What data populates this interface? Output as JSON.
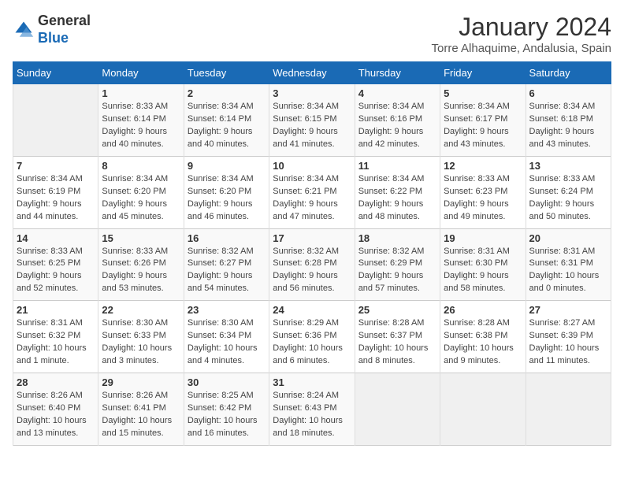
{
  "logo": {
    "line1": "General",
    "line2": "Blue"
  },
  "title": "January 2024",
  "subtitle": "Torre Alhaquime, Andalusia, Spain",
  "columns": [
    "Sunday",
    "Monday",
    "Tuesday",
    "Wednesday",
    "Thursday",
    "Friday",
    "Saturday"
  ],
  "rows": [
    [
      {
        "num": "",
        "info": ""
      },
      {
        "num": "1",
        "info": "Sunrise: 8:33 AM\nSunset: 6:14 PM\nDaylight: 9 hours\nand 40 minutes."
      },
      {
        "num": "2",
        "info": "Sunrise: 8:34 AM\nSunset: 6:14 PM\nDaylight: 9 hours\nand 40 minutes."
      },
      {
        "num": "3",
        "info": "Sunrise: 8:34 AM\nSunset: 6:15 PM\nDaylight: 9 hours\nand 41 minutes."
      },
      {
        "num": "4",
        "info": "Sunrise: 8:34 AM\nSunset: 6:16 PM\nDaylight: 9 hours\nand 42 minutes."
      },
      {
        "num": "5",
        "info": "Sunrise: 8:34 AM\nSunset: 6:17 PM\nDaylight: 9 hours\nand 43 minutes."
      },
      {
        "num": "6",
        "info": "Sunrise: 8:34 AM\nSunset: 6:18 PM\nDaylight: 9 hours\nand 43 minutes."
      }
    ],
    [
      {
        "num": "7",
        "info": "Sunrise: 8:34 AM\nSunset: 6:19 PM\nDaylight: 9 hours\nand 44 minutes."
      },
      {
        "num": "8",
        "info": "Sunrise: 8:34 AM\nSunset: 6:20 PM\nDaylight: 9 hours\nand 45 minutes."
      },
      {
        "num": "9",
        "info": "Sunrise: 8:34 AM\nSunset: 6:20 PM\nDaylight: 9 hours\nand 46 minutes."
      },
      {
        "num": "10",
        "info": "Sunrise: 8:34 AM\nSunset: 6:21 PM\nDaylight: 9 hours\nand 47 minutes."
      },
      {
        "num": "11",
        "info": "Sunrise: 8:34 AM\nSunset: 6:22 PM\nDaylight: 9 hours\nand 48 minutes."
      },
      {
        "num": "12",
        "info": "Sunrise: 8:33 AM\nSunset: 6:23 PM\nDaylight: 9 hours\nand 49 minutes."
      },
      {
        "num": "13",
        "info": "Sunrise: 8:33 AM\nSunset: 6:24 PM\nDaylight: 9 hours\nand 50 minutes."
      }
    ],
    [
      {
        "num": "14",
        "info": "Sunrise: 8:33 AM\nSunset: 6:25 PM\nDaylight: 9 hours\nand 52 minutes."
      },
      {
        "num": "15",
        "info": "Sunrise: 8:33 AM\nSunset: 6:26 PM\nDaylight: 9 hours\nand 53 minutes."
      },
      {
        "num": "16",
        "info": "Sunrise: 8:32 AM\nSunset: 6:27 PM\nDaylight: 9 hours\nand 54 minutes."
      },
      {
        "num": "17",
        "info": "Sunrise: 8:32 AM\nSunset: 6:28 PM\nDaylight: 9 hours\nand 56 minutes."
      },
      {
        "num": "18",
        "info": "Sunrise: 8:32 AM\nSunset: 6:29 PM\nDaylight: 9 hours\nand 57 minutes."
      },
      {
        "num": "19",
        "info": "Sunrise: 8:31 AM\nSunset: 6:30 PM\nDaylight: 9 hours\nand 58 minutes."
      },
      {
        "num": "20",
        "info": "Sunrise: 8:31 AM\nSunset: 6:31 PM\nDaylight: 10 hours\nand 0 minutes."
      }
    ],
    [
      {
        "num": "21",
        "info": "Sunrise: 8:31 AM\nSunset: 6:32 PM\nDaylight: 10 hours\nand 1 minute."
      },
      {
        "num": "22",
        "info": "Sunrise: 8:30 AM\nSunset: 6:33 PM\nDaylight: 10 hours\nand 3 minutes."
      },
      {
        "num": "23",
        "info": "Sunrise: 8:30 AM\nSunset: 6:34 PM\nDaylight: 10 hours\nand 4 minutes."
      },
      {
        "num": "24",
        "info": "Sunrise: 8:29 AM\nSunset: 6:36 PM\nDaylight: 10 hours\nand 6 minutes."
      },
      {
        "num": "25",
        "info": "Sunrise: 8:28 AM\nSunset: 6:37 PM\nDaylight: 10 hours\nand 8 minutes."
      },
      {
        "num": "26",
        "info": "Sunrise: 8:28 AM\nSunset: 6:38 PM\nDaylight: 10 hours\nand 9 minutes."
      },
      {
        "num": "27",
        "info": "Sunrise: 8:27 AM\nSunset: 6:39 PM\nDaylight: 10 hours\nand 11 minutes."
      }
    ],
    [
      {
        "num": "28",
        "info": "Sunrise: 8:26 AM\nSunset: 6:40 PM\nDaylight: 10 hours\nand 13 minutes."
      },
      {
        "num": "29",
        "info": "Sunrise: 8:26 AM\nSunset: 6:41 PM\nDaylight: 10 hours\nand 15 minutes."
      },
      {
        "num": "30",
        "info": "Sunrise: 8:25 AM\nSunset: 6:42 PM\nDaylight: 10 hours\nand 16 minutes."
      },
      {
        "num": "31",
        "info": "Sunrise: 8:24 AM\nSunset: 6:43 PM\nDaylight: 10 hours\nand 18 minutes."
      },
      {
        "num": "",
        "info": ""
      },
      {
        "num": "",
        "info": ""
      },
      {
        "num": "",
        "info": ""
      }
    ]
  ]
}
